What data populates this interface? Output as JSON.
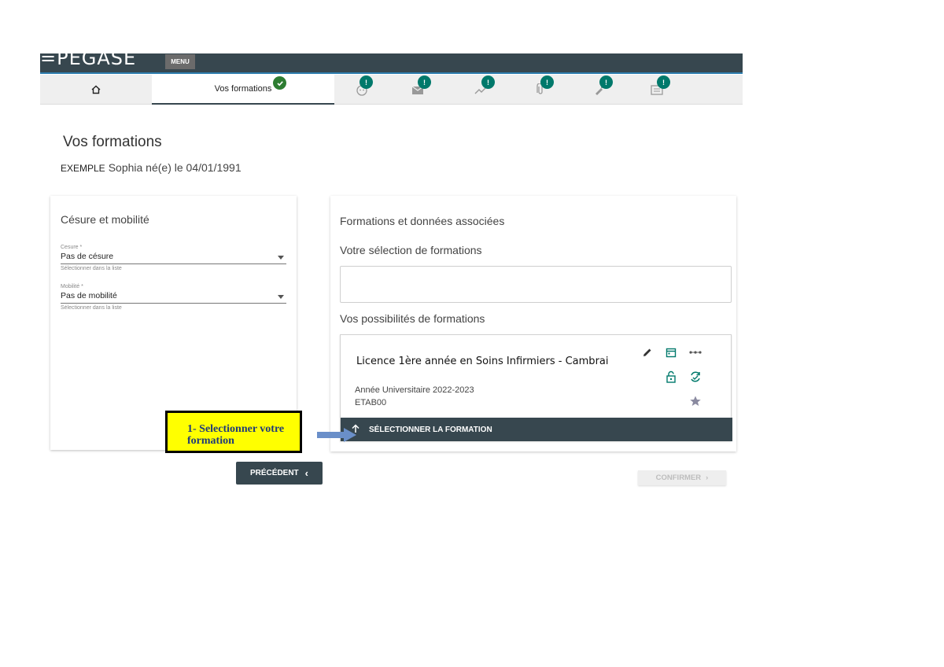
{
  "header": {
    "logo": "=PEGASE",
    "menu_label": "MENU"
  },
  "steps": {
    "active_label": "Vos formations",
    "items": [
      {
        "name": "home",
        "icon": "home-icon"
      },
      {
        "name": "vos-formations",
        "icon": "check-icon",
        "label": "Vos formations"
      },
      {
        "name": "profil",
        "icon": "face-icon",
        "badge": "!"
      },
      {
        "name": "contact",
        "icon": "mail-icon",
        "badge": "!"
      },
      {
        "name": "parcours",
        "icon": "trending-icon",
        "badge": "!"
      },
      {
        "name": "pieces",
        "icon": "paperclip-icon",
        "badge": "!"
      },
      {
        "name": "paiement",
        "icon": "pen-icon",
        "badge": "!"
      },
      {
        "name": "recap",
        "icon": "calendar-icon",
        "badge": "!"
      }
    ]
  },
  "page": {
    "title": "Vos formations",
    "student_surname": "EXEMPLE",
    "student_rest": "Sophia né(e) le 04/01/1991"
  },
  "cesure": {
    "title": "Césure et mobilité",
    "cesure_label": "Cesure *",
    "cesure_value": "Pas de césure",
    "cesure_hint": "Sélectionner dans la liste",
    "mobilite_label": "Mobilité *",
    "mobilite_value": "Pas de mobilité",
    "mobilite_hint": "Sélectionner dans la liste"
  },
  "formations": {
    "section_title": "Formations et données associées",
    "selection_title": "Votre sélection de formations",
    "possibilities_title": "Vos possibilités de formations",
    "card": {
      "name": "Licence 1ère année en Soins Infirmiers - Cambrai",
      "year": "Année Universitaire 2022-2023",
      "etab": "ETAB00",
      "select_label": "SÉLECTIONNER LA FORMATION"
    }
  },
  "buttons": {
    "previous": "PRÉCÉDENT",
    "confirm": "CONFIRMER"
  },
  "annotation": {
    "line1": "1- Selectionner votre",
    "line2": "formation"
  },
  "colors": {
    "primary": "#37474f",
    "accent": "#00796b",
    "annotation_bg": "#ffff00",
    "arrow": "#6a8fc9"
  }
}
